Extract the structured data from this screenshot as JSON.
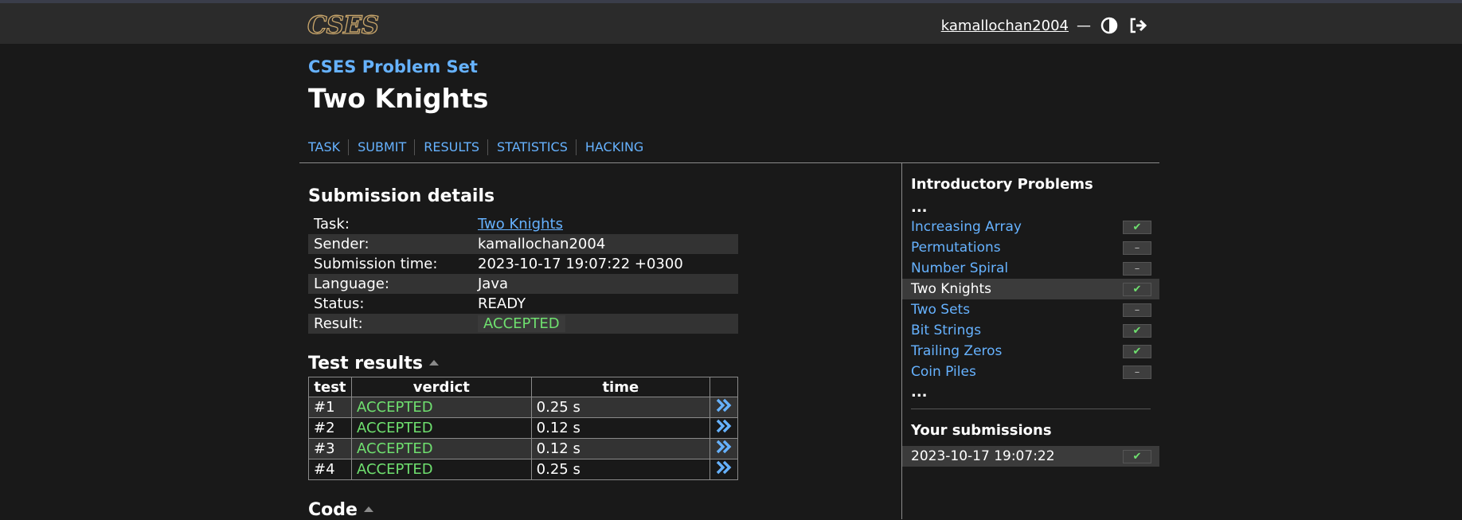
{
  "header": {
    "logo": "CSES",
    "username": "kamallochan2004",
    "dash": "—"
  },
  "page": {
    "set_title": "CSES Problem Set",
    "title": "Two Knights"
  },
  "tabs": [
    "TASK",
    "SUBMIT",
    "RESULTS",
    "STATISTICS",
    "HACKING"
  ],
  "submission": {
    "heading": "Submission details",
    "rows": [
      {
        "label": "Task:",
        "value": "Two Knights"
      },
      {
        "label": "Sender:",
        "value": "kamallochan2004"
      },
      {
        "label": "Submission time:",
        "value": "2023-10-17 19:07:22 +0300"
      },
      {
        "label": "Language:",
        "value": "Java"
      },
      {
        "label": "Status:",
        "value": "READY"
      },
      {
        "label": "Result:",
        "value": "ACCEPTED"
      }
    ]
  },
  "tests": {
    "heading": "Test results",
    "columns": [
      "test",
      "verdict",
      "time"
    ],
    "rows": [
      {
        "test": "#1",
        "verdict": "ACCEPTED",
        "time": "0.25 s"
      },
      {
        "test": "#2",
        "verdict": "ACCEPTED",
        "time": "0.12 s"
      },
      {
        "test": "#3",
        "verdict": "ACCEPTED",
        "time": "0.12 s"
      },
      {
        "test": "#4",
        "verdict": "ACCEPTED",
        "time": "0.25 s"
      }
    ]
  },
  "code_heading": "Code",
  "sidebar": {
    "section_title": "Introductory Problems",
    "ellipsis": "...",
    "problems": [
      {
        "name": "Increasing Array",
        "status": "✔"
      },
      {
        "name": "Permutations",
        "status": "–"
      },
      {
        "name": "Number Spiral",
        "status": "–"
      },
      {
        "name": "Two Knights",
        "status": "✔"
      },
      {
        "name": "Two Sets",
        "status": "–"
      },
      {
        "name": "Bit Strings",
        "status": "✔"
      },
      {
        "name": "Trailing Zeros",
        "status": "✔"
      },
      {
        "name": "Coin Piles",
        "status": "–"
      }
    ],
    "submissions_title": "Your submissions",
    "submissions": [
      {
        "time": "2023-10-17 19:07:22",
        "status": "✔"
      }
    ]
  },
  "colors": {
    "accent": "#66b2ff",
    "accepted": "#6fe06f",
    "logo": "#c9a66b"
  }
}
